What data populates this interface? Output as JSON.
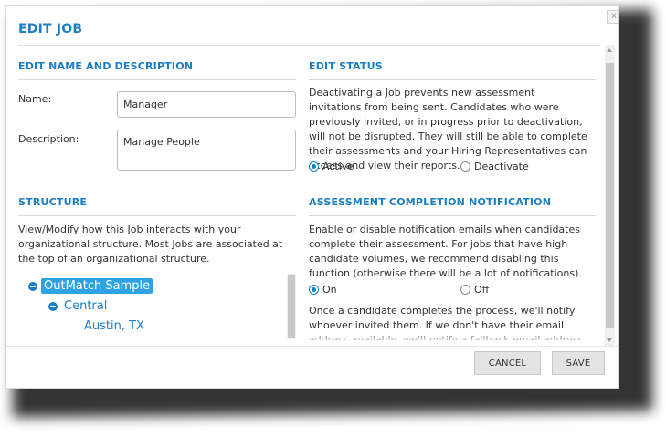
{
  "dialog": {
    "title": "EDIT JOB",
    "close_label": "x"
  },
  "edit_name": {
    "heading": "EDIT NAME AND DESCRIPTION",
    "name_label": "Name:",
    "name_value": "Manager",
    "description_label": "Description:",
    "description_value": "Manage People"
  },
  "edit_status": {
    "heading": "EDIT STATUS",
    "text": "Deactivating a Job prevents new assessment invitations from being sent. Candidates who were previously invited, or in progress prior to deactivation, will not be disrupted. They will still be able to complete their assessments and your Hiring Representatives can access and view their reports.",
    "options": [
      {
        "label": "Active",
        "checked": true
      },
      {
        "label": "Deactivate",
        "checked": false
      }
    ]
  },
  "structure": {
    "heading": "STRUCTURE",
    "text": "View/Modify how this Job interacts with your organizational structure. Most Jobs are associated at the top of an organizational structure.",
    "tree": [
      {
        "label": "OutMatch Sample",
        "level": 0,
        "selected": true,
        "expandable": true
      },
      {
        "label": "Central",
        "level": 1,
        "selected": false,
        "expandable": true
      },
      {
        "label": "Austin, TX",
        "level": 2,
        "selected": false,
        "expandable": false
      }
    ]
  },
  "notification": {
    "heading": "ASSESSMENT COMPLETION NOTIFICATION",
    "text": "Enable or disable notification emails when candidates complete their assessment. For jobs that have high candidate volumes, we recommend disabling this function (otherwise there will be a lot of notifications).",
    "options": [
      {
        "label": "On",
        "checked": true
      },
      {
        "label": "Off",
        "checked": false
      }
    ],
    "text2": "Once a candidate completes the process, we'll notify whoever invited them. If we don't have their email address available, we'll notify a fallback email address, which you can provide"
  },
  "footer": {
    "cancel_label": "CANCEL",
    "save_label": "SAVE"
  }
}
